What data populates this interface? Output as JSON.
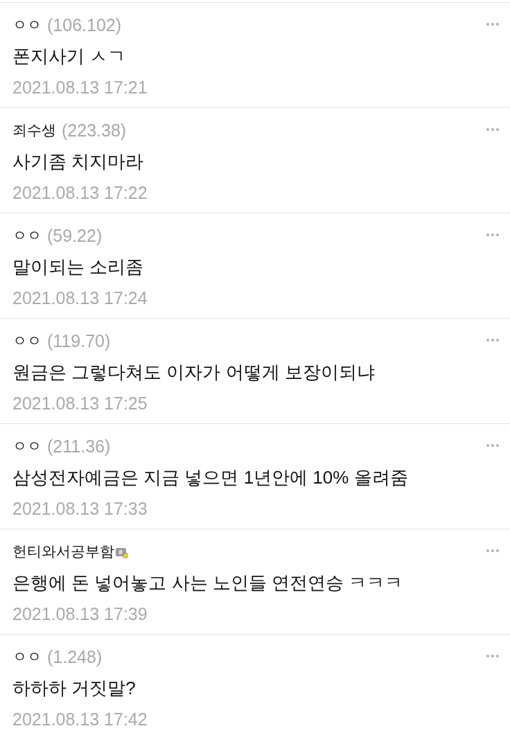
{
  "comments": [
    {
      "author": "ㅇㅇ",
      "ip": "(106.102)",
      "text": "폰지사기 ㅅㄱ",
      "time": "2021.08.13 17:21"
    },
    {
      "author": "죄수생",
      "ip": "(223.38)",
      "text": "사기좀 치지마라",
      "time": "2021.08.13 17:22"
    },
    {
      "author": "ㅇㅇ",
      "ip": "(59.22)",
      "text": "말이되는 소리좀",
      "time": "2021.08.13 17:24"
    },
    {
      "author": "ㅇㅇ",
      "ip": "(119.70)",
      "text": "원금은 그렇다쳐도 이자가 어떻게 보장이되냐",
      "time": "2021.08.13 17:25"
    },
    {
      "author": "ㅇㅇ",
      "ip": "(211.36)",
      "text": "삼성전자예금은 지금 넣으면 1년안에 10% 올려줌",
      "time": "2021.08.13 17:33"
    },
    {
      "author": "헌티와서공부함",
      "badge": true,
      "text": "은행에 돈 넣어놓고 사는 노인들 연전연승 ㅋㅋㅋ",
      "time": "2021.08.13 17:39"
    },
    {
      "author": "ㅇㅇ",
      "ip": "(1.248)",
      "text": "하하하 거짓말?",
      "time": "2021.08.13 17:42"
    }
  ]
}
